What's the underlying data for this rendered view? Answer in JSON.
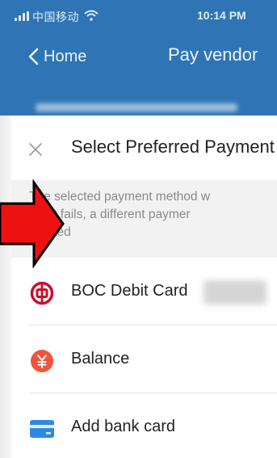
{
  "status_bar": {
    "carrier": "中国移动",
    "time": "10:14 PM"
  },
  "nav": {
    "back_label": "Home",
    "title": "Pay vendor"
  },
  "sheet": {
    "title": "Select Preferred Payment",
    "description_lines": [
      "The selected payment method w",
      "ment fails, a different paymer",
      "empted"
    ],
    "methods": [
      {
        "label": "BOC Debit Card",
        "icon": "boc-bank-logo-icon"
      },
      {
        "label": "Balance",
        "icon": "yuan-balance-icon"
      },
      {
        "label": "Add bank card",
        "icon": "bank-card-icon"
      }
    ]
  },
  "colors": {
    "header_blue": "#2f75b5",
    "boc_red": "#c8102e",
    "balance_orange": "#f0553b",
    "card_blue": "#2d8ae0",
    "annotation_red": "#ee1111"
  }
}
